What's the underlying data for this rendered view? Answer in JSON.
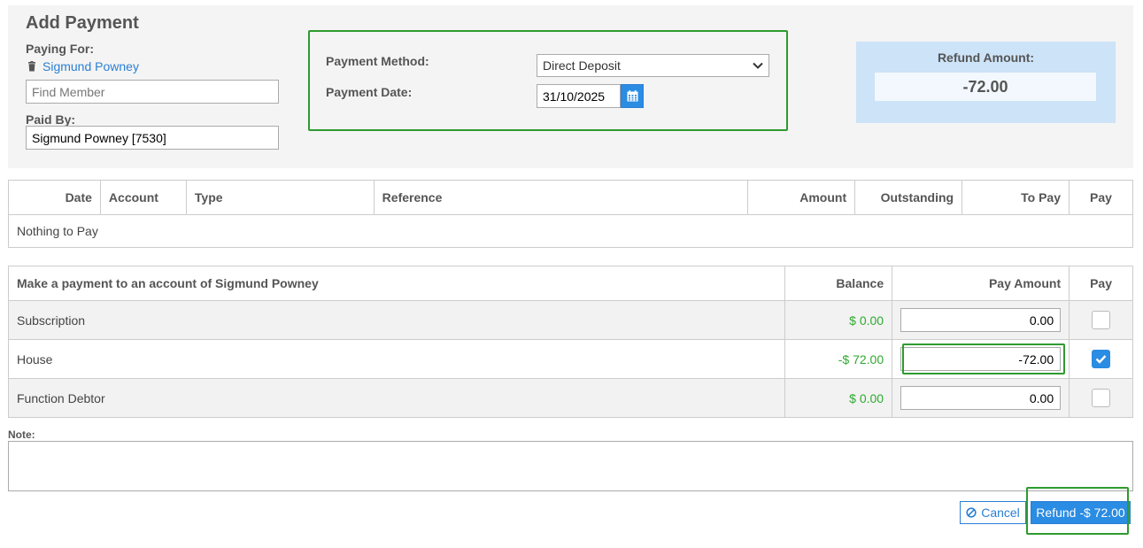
{
  "title": "Add Payment",
  "paying_for": {
    "label": "Paying For:",
    "member_name": "Sigmund Powney",
    "icon": "trash-icon"
  },
  "find_member": {
    "placeholder": "Find Member",
    "value": ""
  },
  "paid_by": {
    "label": "Paid By:",
    "value": "Sigmund Powney [7530]"
  },
  "payment": {
    "method_label": "Payment Method:",
    "method_value": "Direct Deposit",
    "date_label": "Payment Date:",
    "date_value": "31/10/2025"
  },
  "refund": {
    "label": "Refund Amount:",
    "value": "-72.00"
  },
  "transactions": {
    "headers": [
      "Date",
      "Account",
      "Type",
      "Reference",
      "Amount",
      "Outstanding",
      "To Pay",
      "Pay"
    ],
    "empty_message": "Nothing to Pay"
  },
  "accounts": {
    "headers": [
      "Make a payment to an account of Sigmund Powney",
      "Balance",
      "Pay Amount",
      "Pay"
    ],
    "rows": [
      {
        "name": "Subscription",
        "balance": "$ 0.00",
        "pay_amount": "0.00",
        "checked": false
      },
      {
        "name": "House",
        "balance": "-$ 72.00",
        "pay_amount": "-72.00",
        "checked": true
      },
      {
        "name": "Function Debtor",
        "balance": "$ 0.00",
        "pay_amount": "0.00",
        "checked": false
      }
    ]
  },
  "note": {
    "label": "Note:",
    "value": ""
  },
  "actions": {
    "cancel_label": "Cancel",
    "refund_label": "Refund -$ 72.00"
  },
  "colors": {
    "accent": "#2a8ce2",
    "highlight": "#2e9a2e",
    "balance_text": "#2eaa2e",
    "refund_bg": "#cce3f8"
  }
}
